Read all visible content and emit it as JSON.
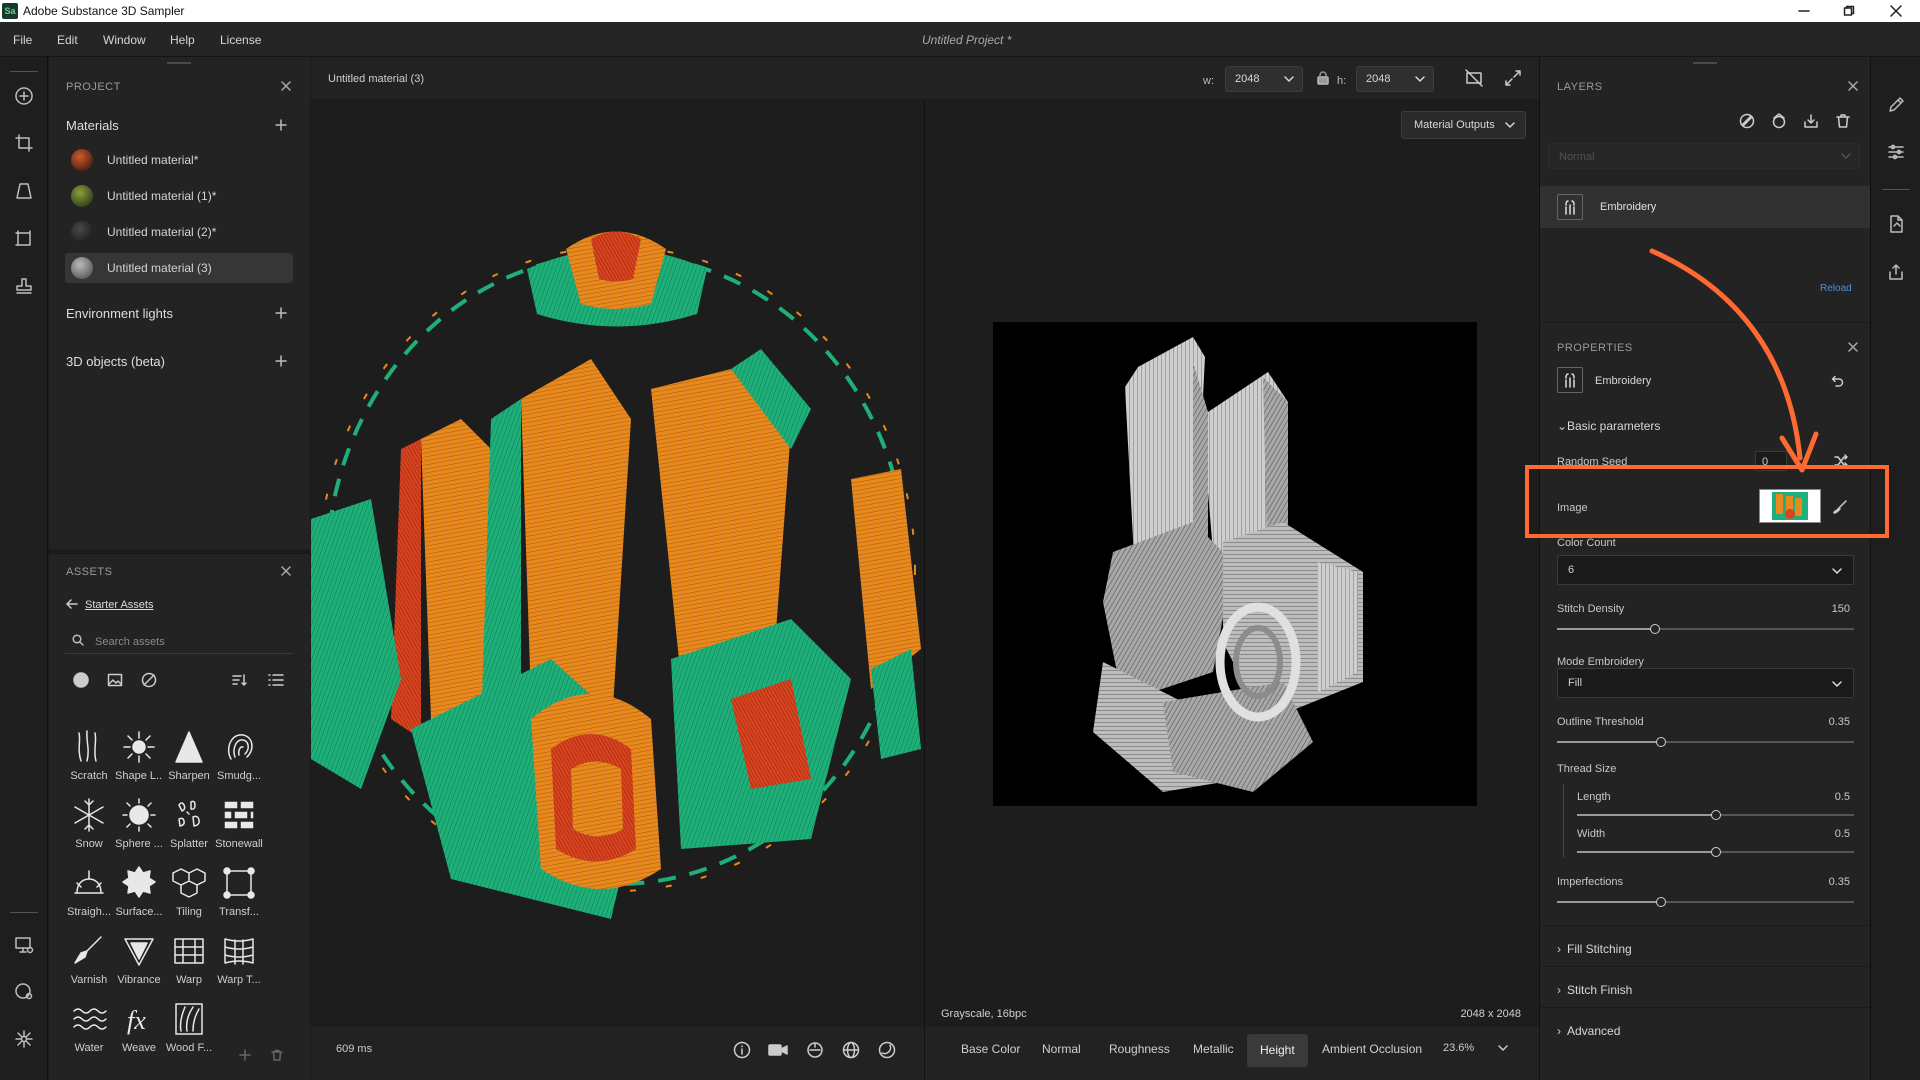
{
  "app": {
    "title": "Adobe Substance 3D Sampler",
    "logo": "Sa",
    "project_title": "Untitled Project *"
  },
  "menu": [
    "File",
    "Edit",
    "Window",
    "Help",
    "License"
  ],
  "project": {
    "title": "PROJECT",
    "materials_header": "Materials",
    "materials": [
      "Untitled material*",
      "Untitled material (1)*",
      "Untitled material (2)*",
      "Untitled material (3)"
    ],
    "env_lights": "Environment lights",
    "objects_3d": "3D objects (beta)"
  },
  "assets": {
    "title": "ASSETS",
    "breadcrumb": "Starter Assets",
    "search_placeholder": "Search assets",
    "tiles": [
      "Scratch",
      "Shape L...",
      "Sharpen",
      "Smudg...",
      "Snow",
      "Sphere ...",
      "Splatter",
      "Stonewall",
      "Straigh...",
      "Surface...",
      "Tiling",
      "Transf...",
      "Varnish",
      "Vibrance",
      "Warp",
      "Warp T...",
      "Water",
      "Weave",
      "Wood F..."
    ],
    "tile_icons": [
      "scratch-icon",
      "shape-light-icon",
      "sharpen-icon",
      "smudge-icon",
      "snow-icon",
      "sphere-icon",
      "splatter-icon",
      "stonewall-icon",
      "straighten-icon",
      "surface-icon",
      "tiling-icon",
      "transform-icon",
      "varnish-icon",
      "vibrance-icon",
      "warp-icon",
      "warp-transform-icon",
      "water-icon",
      "weave-icon",
      "wood-fx-icon"
    ]
  },
  "viewport": {
    "material_name": "Untitled material (3)",
    "w_label": "w:",
    "w_value": "2048",
    "h_label": "h:",
    "h_value": "2048",
    "outputs_button": "Material Outputs",
    "render_time": "609 ms",
    "format": "Grayscale, 16bpc",
    "resolution": "2048 x 2048",
    "channels": [
      "Base Color",
      "Normal",
      "Roughness",
      "Metallic",
      "Height",
      "Ambient Occlusion"
    ],
    "active_channel": "Height",
    "zoom": "23.6%"
  },
  "layers": {
    "title": "LAYERS",
    "blend_mode": "Normal",
    "layer_name": "Embroidery",
    "reload": "Reload"
  },
  "properties": {
    "title": "PROPERTIES",
    "filter_name": "Embroidery",
    "basic_parameters": "Basic parameters",
    "random_seed_label": "Random Seed",
    "random_seed_value": "0",
    "image_label": "Image",
    "color_count_label": "Color Count",
    "color_count_value": "6",
    "stitch_density_label": "Stitch Density",
    "stitch_density_value": "150",
    "stitch_density_fraction": 0.33,
    "mode_label": "Mode Embroidery",
    "mode_value": "Fill",
    "outline_threshold_label": "Outline Threshold",
    "outline_threshold_value": "0.35",
    "outline_threshold_fraction": 0.35,
    "thread_size_label": "Thread Size",
    "length_label": "Length",
    "length_value": "0.5",
    "length_fraction": 0.5,
    "width_label": "Width",
    "width_value": "0.5",
    "width_fraction": 0.5,
    "imperfections_label": "Imperfections",
    "imperfections_value": "0.35",
    "imperfections_fraction": 0.35,
    "fill_stitching": "Fill Stitching",
    "stitch_finish": "Stitch Finish",
    "advanced": "Advanced"
  },
  "colors": {
    "accent": "#ff6a33",
    "link": "#4a90e2",
    "embroidery_green": "#1fb07a",
    "embroidery_orange": "#e8891e",
    "embroidery_red": "#d9431f"
  }
}
